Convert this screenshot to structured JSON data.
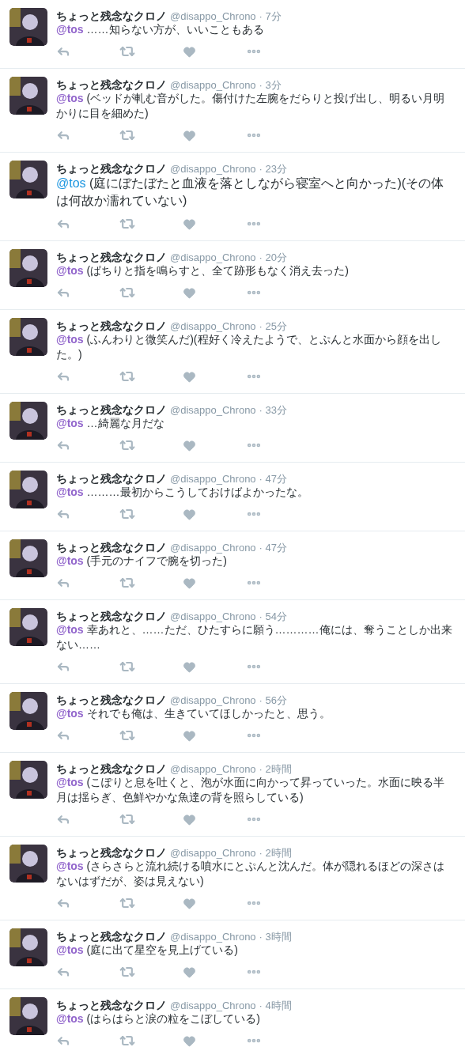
{
  "tweets": [
    {
      "kind": "normal",
      "name": "ちょっと残念なクロノ",
      "handle": "@disappo_Chrono",
      "time": "· 7分",
      "mention": "@tos",
      "text": "……知らない方が、いいこともある"
    },
    {
      "kind": "normal",
      "name": "ちょっと残念なクロノ",
      "handle": "@disappo_Chrono",
      "time": "· 3分",
      "mention": "@tos",
      "text": "(ベッドが軋む音がした。傷付けた左腕をだらりと投げ出し、明るい月明かりに目を細めた)"
    },
    {
      "kind": "large",
      "name": "ちょっと残念なクロノ",
      "handle": "@disappo_Chrono",
      "time": "· 23分",
      "mention": "@tos",
      "text": "(庭にぼたぼたと血液を落としながら寝室へと向かった)(その体は何故か濡れていない)"
    },
    {
      "kind": "normal",
      "name": "ちょっと残念なクロノ",
      "handle": "@disappo_Chrono",
      "time": "· 20分",
      "mention": "@tos",
      "text": "(ぱちりと指を鳴らすと、全て跡形もなく消え去った)"
    },
    {
      "kind": "normal",
      "name": "ちょっと残念なクロノ",
      "handle": "@disappo_Chrono",
      "time": "· 25分",
      "mention": "@tos",
      "text": "(ふんわりと微笑んだ)(程好く冷えたようで、とぷんと水面から顔を出した。)"
    },
    {
      "kind": "normal",
      "name": "ちょっと残念なクロノ",
      "handle": "@disappo_Chrono",
      "time": "· 33分",
      "mention": "@tos",
      "text": "…綺麗な月だな"
    },
    {
      "kind": "normal",
      "name": "ちょっと残念なクロノ",
      "handle": "@disappo_Chrono",
      "time": "· 47分",
      "mention": "@tos",
      "text": "………最初からこうしておけばよかったな。"
    },
    {
      "kind": "normal",
      "name": "ちょっと残念なクロノ",
      "handle": "@disappo_Chrono",
      "time": "· 47分",
      "mention": "@tos",
      "text": "(手元のナイフで腕を切った)"
    },
    {
      "kind": "normal",
      "name": "ちょっと残念なクロノ",
      "handle": "@disappo_Chrono",
      "time": "· 54分",
      "mention": "@tos",
      "text": "幸あれと、……ただ、ひたすらに願う…………俺には、奪うことしか出来ない……"
    },
    {
      "kind": "normal",
      "name": "ちょっと残念なクロノ",
      "handle": "@disappo_Chrono",
      "time": "· 56分",
      "mention": "@tos",
      "text": "それでも俺は、生きていてほしかったと、思う。"
    },
    {
      "kind": "normal",
      "name": "ちょっと残念なクロノ",
      "handle": "@disappo_Chrono",
      "time": "· 2時間",
      "mention": "@tos",
      "text": "(こぽりと息を吐くと、泡が水面に向かって昇っていった。水面に映る半月は揺らぎ、色鮮やかな魚達の背を照らしている)"
    },
    {
      "kind": "normal",
      "name": "ちょっと残念なクロノ",
      "handle": "@disappo_Chrono",
      "time": "· 2時間",
      "mention": "@tos",
      "text": "(さらさらと流れ続ける噴水にとぷんと沈んだ。体が隠れるほどの深さはないはずだが、姿は見えない)"
    },
    {
      "kind": "normal",
      "name": "ちょっと残念なクロノ",
      "handle": "@disappo_Chrono",
      "time": "· 3時間",
      "mention": "@tos",
      "text": "(庭に出て星空を見上げている)"
    },
    {
      "kind": "normal",
      "name": "ちょっと残念なクロノ",
      "handle": "@disappo_Chrono",
      "time": "· 4時間",
      "mention": "@tos",
      "text": "(はらはらと涙の粒をこぼしている)"
    }
  ]
}
